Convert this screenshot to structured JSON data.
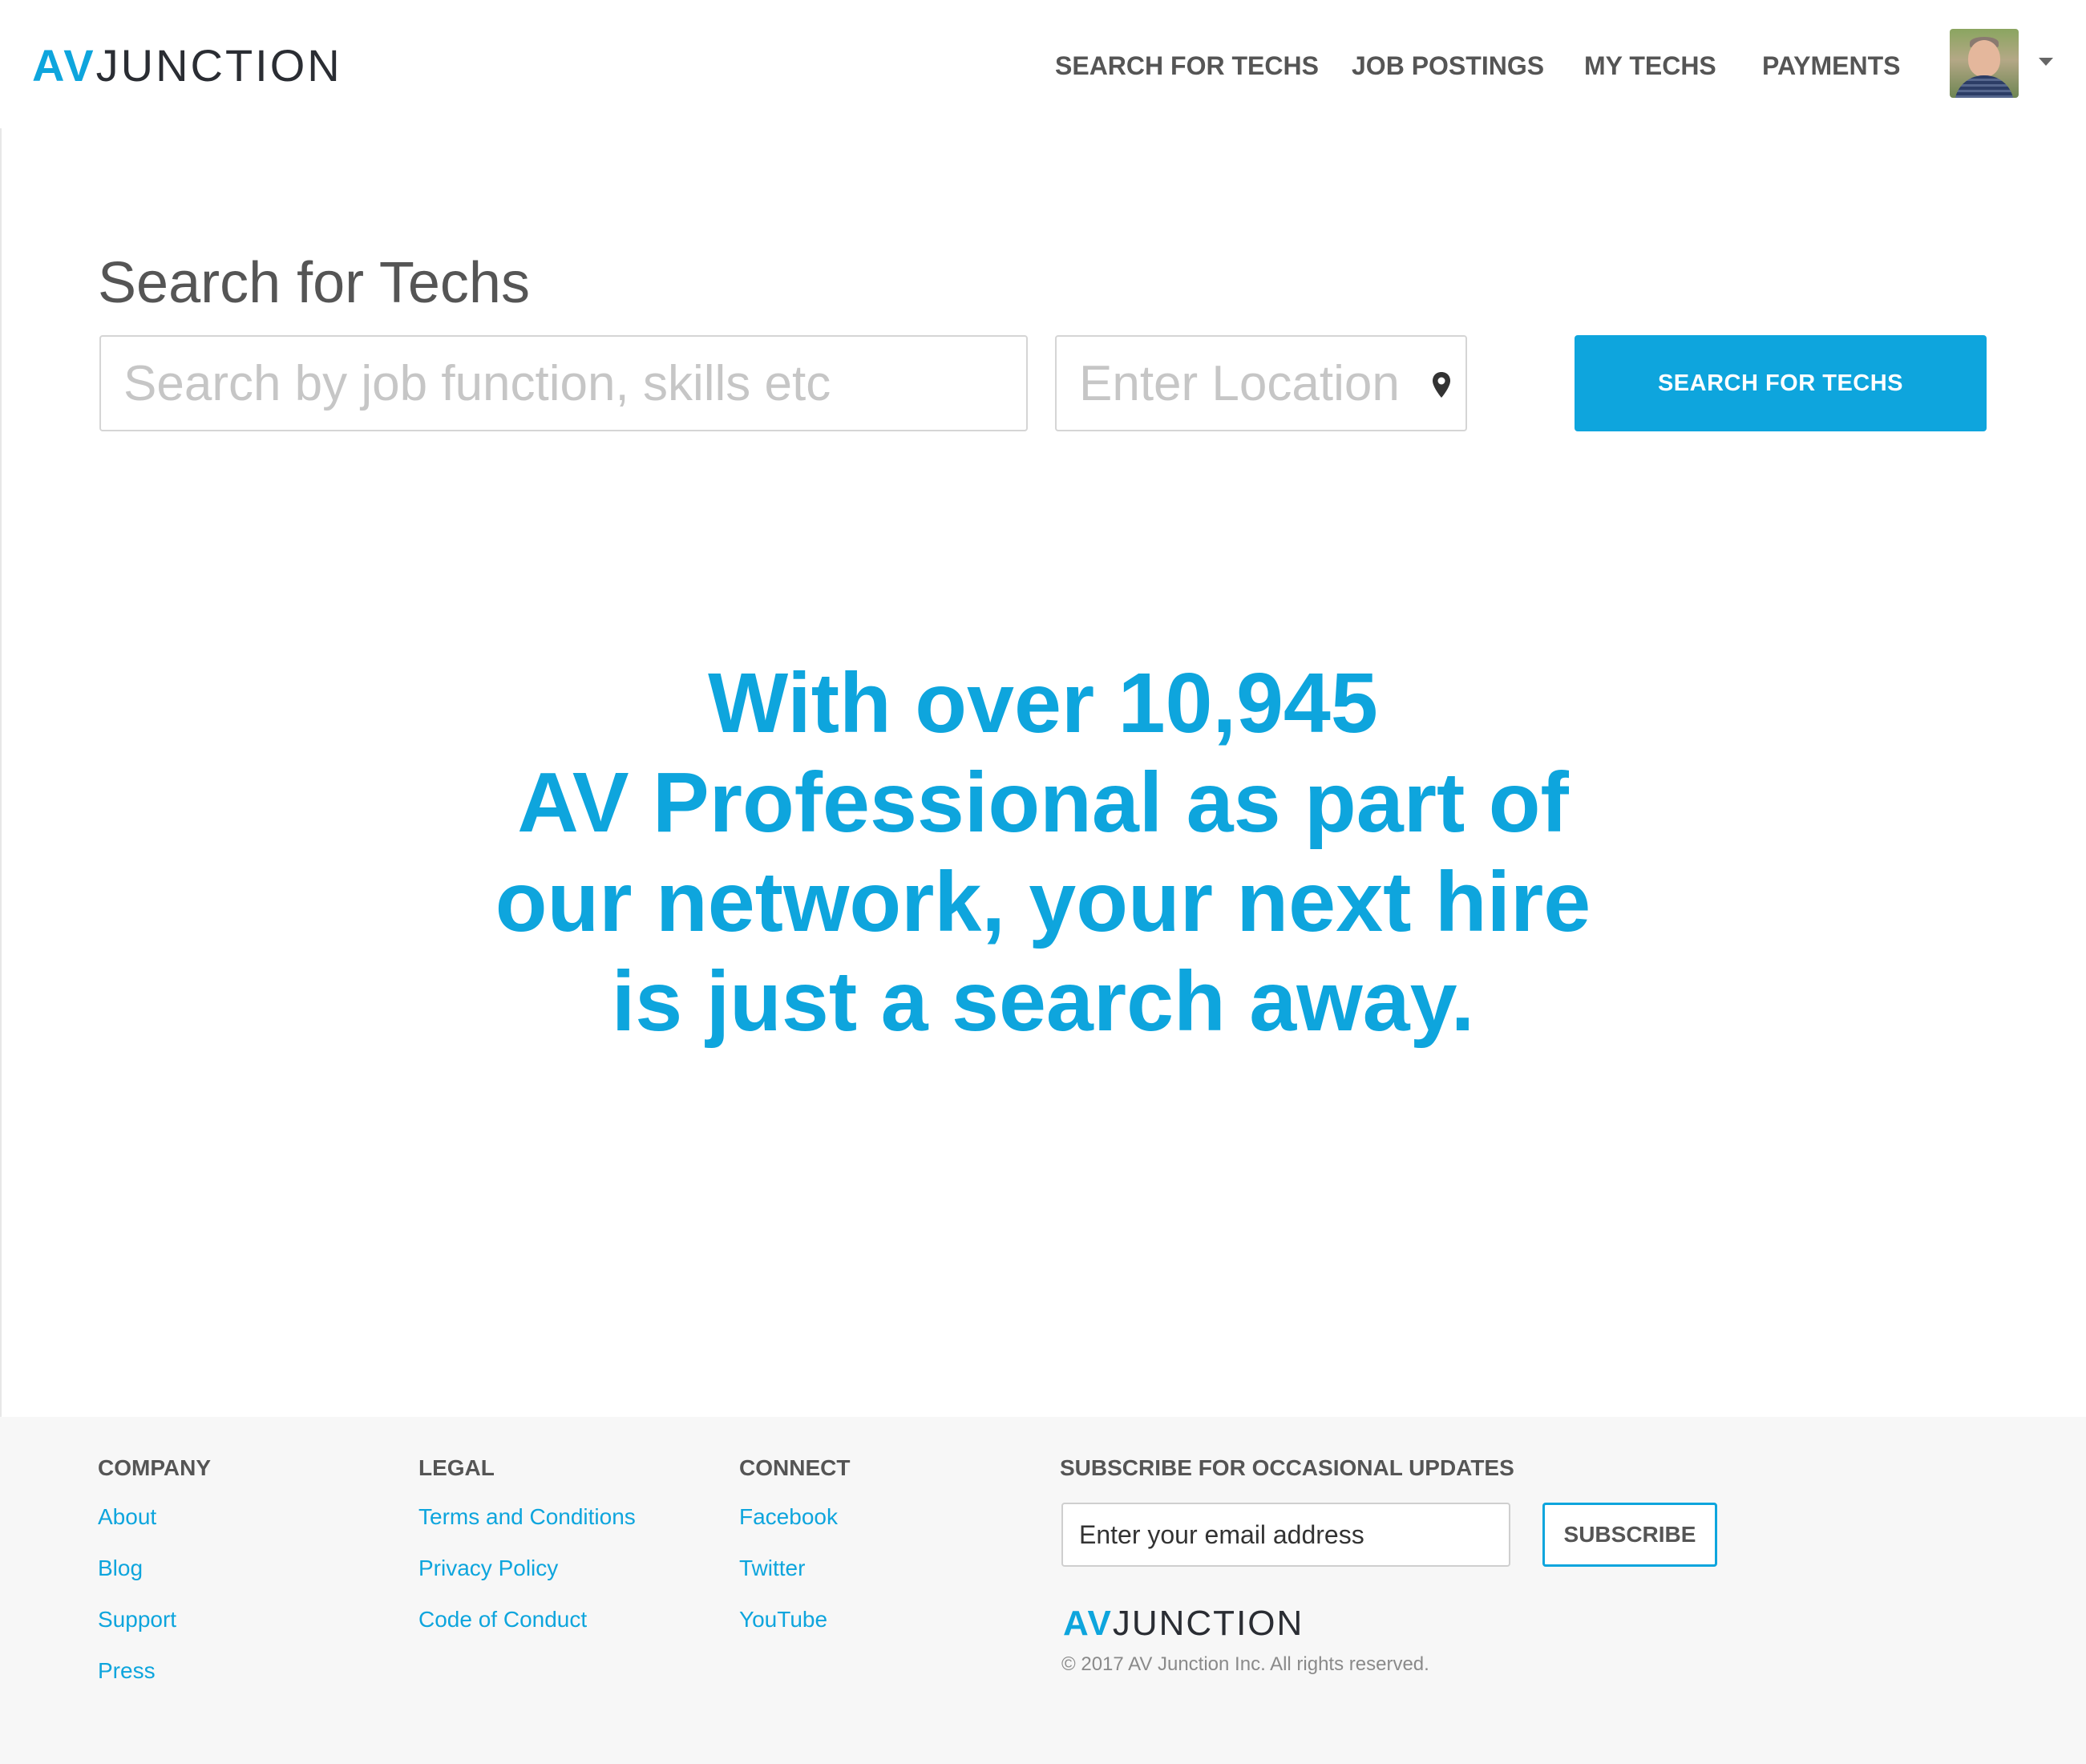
{
  "header": {
    "logo_av": "AV",
    "logo_junction": "JUNCTION",
    "nav": [
      "SEARCH FOR TECHS",
      "JOB POSTINGS",
      "MY TECHS",
      "PAYMENTS"
    ],
    "avatar_icon": "user-avatar",
    "menu_icon": "caret-down-icon"
  },
  "main": {
    "title": "Search for Techs",
    "search_placeholder": "Search by job function, skills etc",
    "location_placeholder": "Enter Location",
    "location_icon": "map-pin-icon",
    "search_button": "SEARCH FOR TECHS",
    "hero_lines": [
      "With over 10,945",
      "AV Professional as part of",
      "our network, your next hire",
      "is just a search away."
    ]
  },
  "footer": {
    "company": {
      "heading": "COMPANY",
      "links": [
        "About",
        "Blog",
        "Support",
        "Press"
      ]
    },
    "legal": {
      "heading": "LEGAL",
      "links": [
        "Terms and Conditions",
        "Privacy Policy",
        "Code of Conduct"
      ]
    },
    "connect": {
      "heading": "CONNECT",
      "links": [
        "Facebook",
        "Twitter",
        "YouTube"
      ]
    },
    "subscribe": {
      "heading": "SUBSCRIBE FOR OCCASIONAL UPDATES",
      "email_placeholder": "Enter your email address",
      "button": "SUBSCRIBE"
    },
    "logo_av": "AV",
    "logo_junction": "JUNCTION",
    "copyright": "© 2017 AV Junction Inc. All rights reserved."
  },
  "colors": {
    "accent": "#0ea5dd",
    "text": "#555555",
    "footer_bg": "#f7f7f7"
  }
}
